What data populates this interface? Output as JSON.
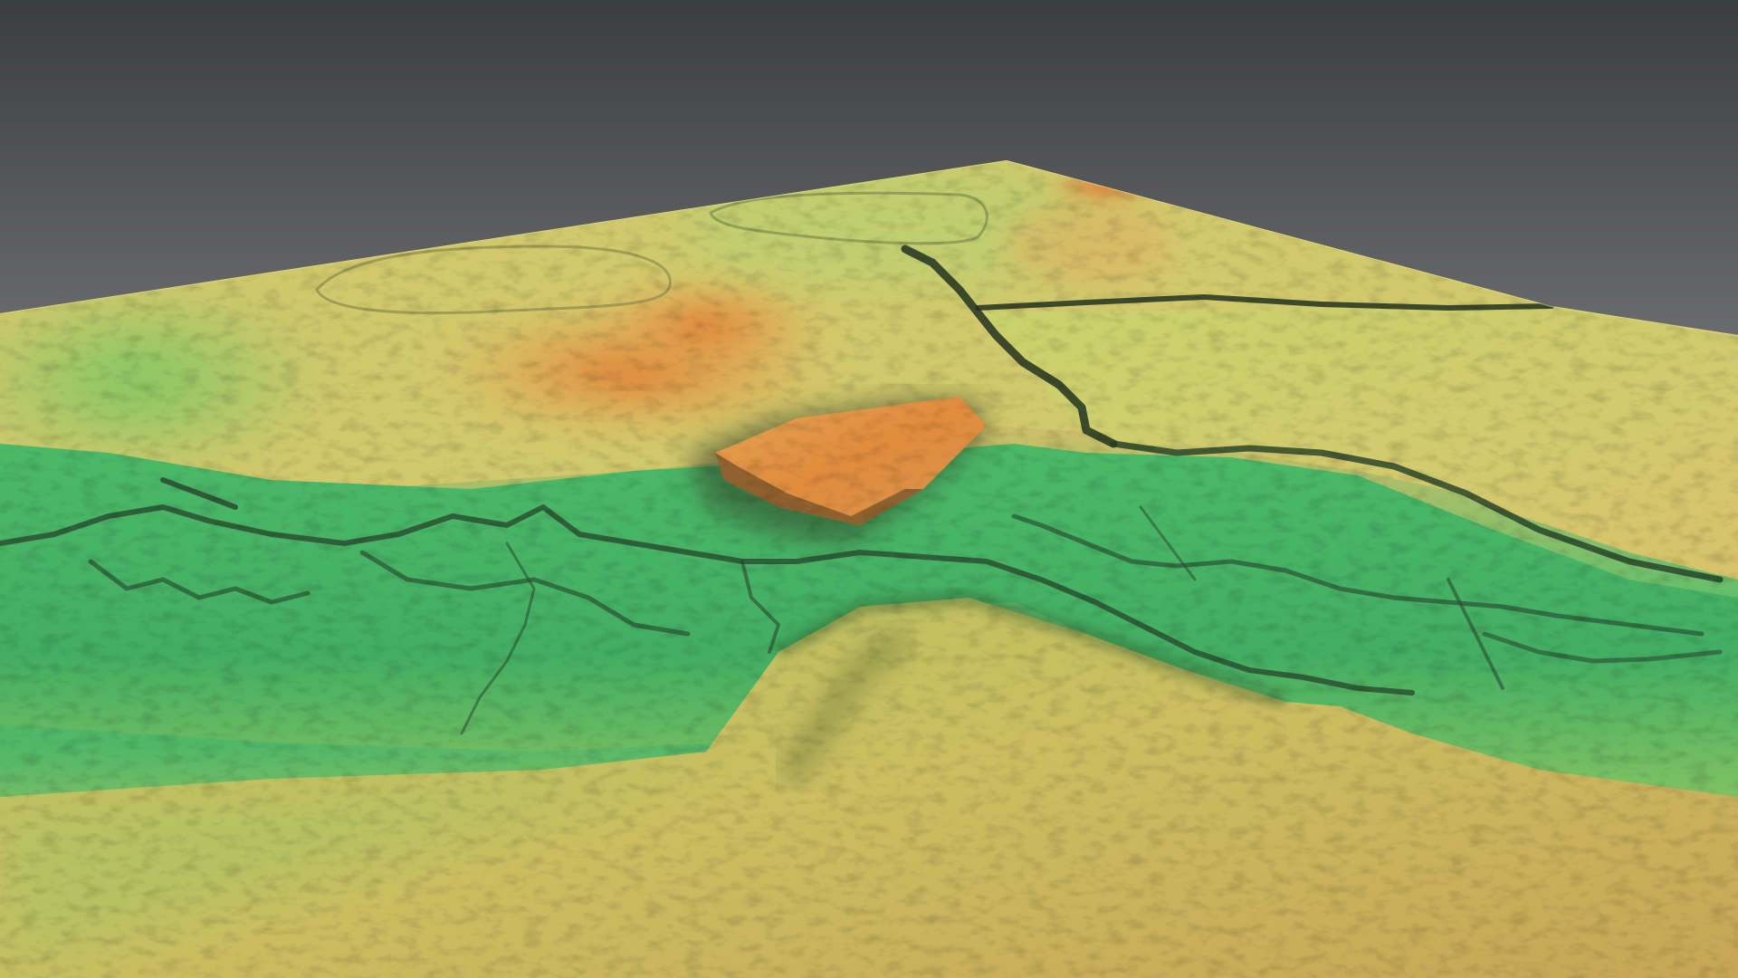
{
  "viewer": {
    "background_color": "#6c6d6f",
    "render_style": "shaded 3D elevation terrain, perspective view",
    "color_ramp": {
      "low": "#2fa85a",
      "mid_low": "#8cc85a",
      "mid": "#d2cb6a",
      "mid_high": "#e2ad55",
      "high": "#e0783a"
    }
  }
}
